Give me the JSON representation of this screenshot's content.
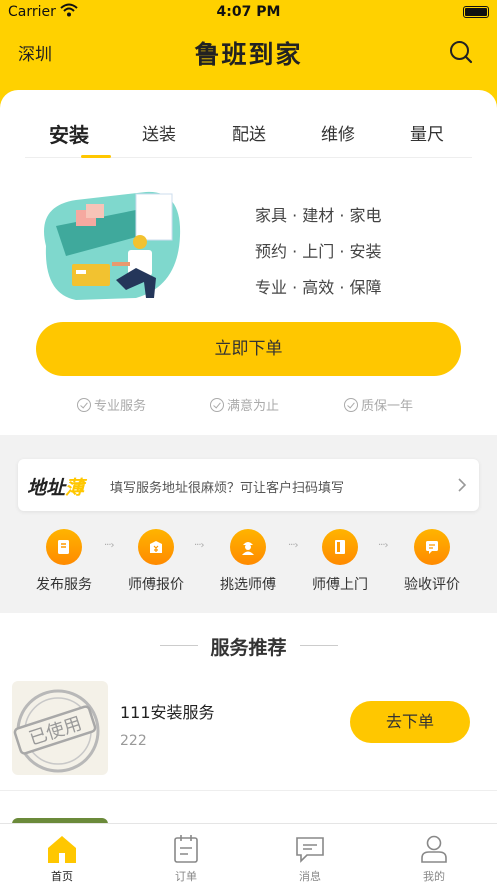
{
  "status_bar": {
    "carrier": "Carrier",
    "time": "4:07 PM"
  },
  "header": {
    "city": "深圳",
    "title": "鲁班到家",
    "icon": "search-icon"
  },
  "service_tabs": [
    "安装",
    "送装",
    "配送",
    "维修",
    "量尺"
  ],
  "features": [
    "家具 · 建材 · 家电",
    "预约 · 上门 · 安装",
    "专业 · 高效 · 保障"
  ],
  "order_button": "立即下单",
  "guarantees": [
    "专业服务",
    "满意为止",
    "质保一年"
  ],
  "address_book": {
    "logo_prefix": "地址",
    "logo_highlight": "薄",
    "text": "填写服务地址很麻烦？可让客户扫码填写"
  },
  "process_steps": [
    {
      "label": "发布服务",
      "icon": "publish-icon"
    },
    {
      "label": "师傅报价",
      "icon": "quote-icon"
    },
    {
      "label": "挑选师傅",
      "icon": "worker-icon"
    },
    {
      "label": "师傅上门",
      "icon": "door-icon"
    },
    {
      "label": "验收评价",
      "icon": "review-icon"
    }
  ],
  "recommend": {
    "title": "服务推荐",
    "items": [
      {
        "name": "111安装服务",
        "price": "222",
        "button": "去下单",
        "stamp": "已使用"
      }
    ]
  },
  "tabbar": [
    {
      "label": "首页",
      "icon": "home-icon",
      "active": true
    },
    {
      "label": "订单",
      "icon": "orders-icon",
      "active": false
    },
    {
      "label": "消息",
      "icon": "message-icon",
      "active": false
    },
    {
      "label": "我的",
      "icon": "profile-icon",
      "active": false
    }
  ],
  "colors": {
    "brand": "#ffd100",
    "button": "#ffc700",
    "step_orange": "#ff9a00"
  }
}
